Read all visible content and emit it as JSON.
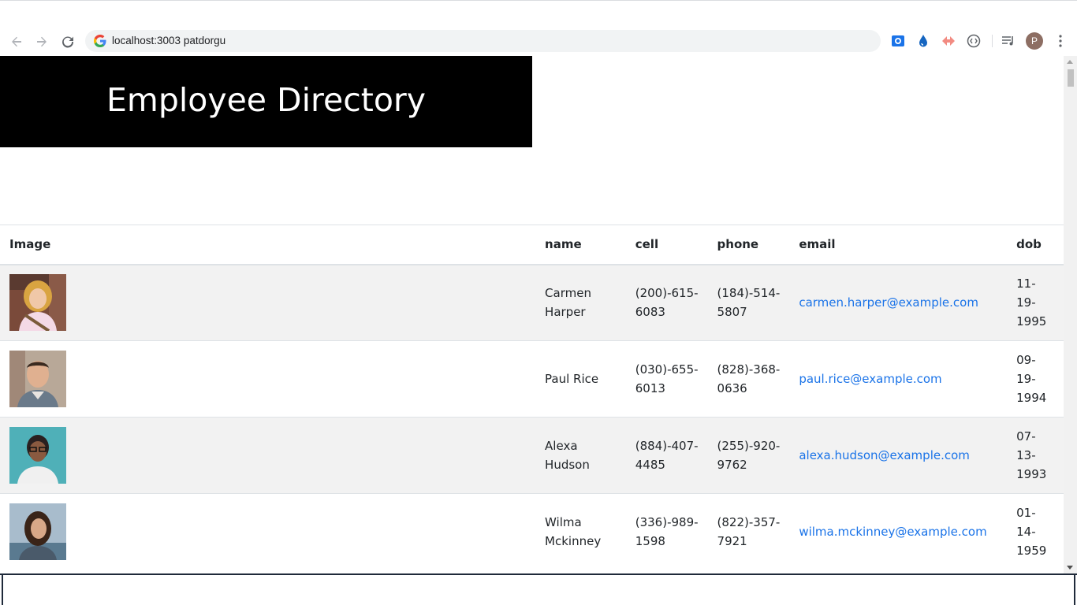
{
  "browser": {
    "url": "localhost:3003 patdorgu",
    "profile_initial": "P",
    "icons": {
      "back": "back-arrow-icon",
      "forward": "forward-arrow-icon",
      "reload": "reload-icon",
      "google": "google-g-icon",
      "ext1": "screen-capture-extension-icon",
      "ext2": "water-drop-extension-icon",
      "ext3": "arrows-extension-icon",
      "ext4": "code-brackets-extension-icon",
      "media": "media-queue-icon",
      "menu": "kebab-menu-icon"
    }
  },
  "page": {
    "title": "Employee Directory"
  },
  "table": {
    "headers": [
      "Image",
      "name",
      "cell",
      "phone",
      "email",
      "dob"
    ],
    "rows": [
      {
        "name_1": "Carmen",
        "name_2": "Harper",
        "cell_1": "(200)-615-",
        "cell_2": "6083",
        "phone_1": "(184)-514-",
        "phone_2": "5807",
        "email": "carmen.harper@example.com",
        "dob_1": "11-19-",
        "dob_2": "1995",
        "photo": "woman-curly-blonde-hair"
      },
      {
        "name_1": "Paul Rice",
        "name_2": "",
        "cell_1": "(030)-655-",
        "cell_2": "6013",
        "phone_1": "(828)-368-",
        "phone_2": "0636",
        "email": "paul.rice@example.com",
        "dob_1": "09-19-",
        "dob_2": "1994",
        "photo": "man-short-dark-hair"
      },
      {
        "name_1": "Alexa",
        "name_2": "Hudson",
        "cell_1": "(884)-407-",
        "cell_2": "4485",
        "phone_1": "(255)-920-",
        "phone_2": "9762",
        "email": "alexa.hudson@example.com",
        "dob_1": "07-13-",
        "dob_2": "1993",
        "photo": "woman-glasses-teal-background"
      },
      {
        "name_1": "Wilma",
        "name_2": "Mckinney",
        "cell_1": "(336)-989-",
        "cell_2": "1598",
        "phone_1": "(822)-357-",
        "phone_2": "7921",
        "email": "wilma.mckinney@example.com",
        "dob_1": "01-14-",
        "dob_2": "1959",
        "photo": "woman-long-dark-hair"
      }
    ]
  },
  "colors": {
    "header_bg": "#000000",
    "header_text": "#ffffff",
    "link": "#1a73e8",
    "stripe": "#f2f2f2"
  }
}
